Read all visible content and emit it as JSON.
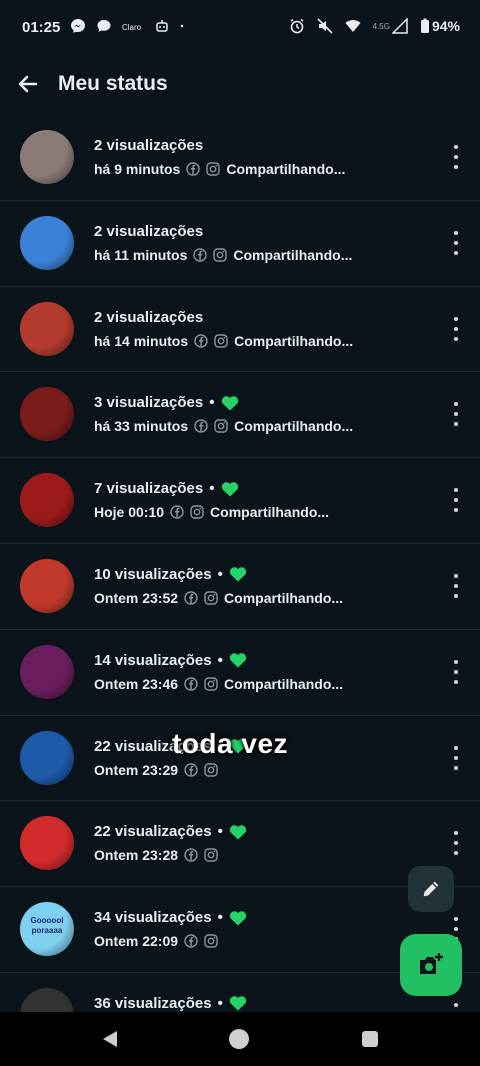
{
  "status_bar": {
    "time": "01:25",
    "left_icons": [
      "messenger-icon",
      "chat-bubble-icon",
      "claro-icon",
      "robot-icon",
      "dot-icon"
    ],
    "right_icons": [
      "alarm-icon",
      "mute-icon",
      "wifi-icon",
      "network-icon",
      "battery-icon"
    ],
    "network_label": "4.5G",
    "battery": "94%"
  },
  "header": {
    "title": "Meu status"
  },
  "rows": [
    {
      "views": "2 visualizações",
      "time": "há 9 minutos",
      "share": "Compartilhando...",
      "liked": false,
      "avatar_color": "#8a7b76"
    },
    {
      "views": "2 visualizações",
      "time": "há 11 minutos",
      "share": "Compartilhando...",
      "liked": false,
      "avatar_color": "#3b82d6"
    },
    {
      "views": "2 visualizações",
      "time": "há 14 minutos",
      "share": "Compartilhando...",
      "liked": false,
      "avatar_color": "#b23a2e"
    },
    {
      "views": "3 visualizações",
      "time": "há 33 minutos",
      "share": "Compartilhando...",
      "liked": true,
      "avatar_color": "#7a1d1a"
    },
    {
      "views": "7 visualizações",
      "time": "Hoje 00:10",
      "share": "Compartilhando...",
      "liked": true,
      "avatar_color": "#9b1b1b"
    },
    {
      "views": "10 visualizações",
      "time": "Ontem 23:52",
      "share": "Compartilhando...",
      "liked": true,
      "avatar_color": "#c0392b"
    },
    {
      "views": "14 visualizações",
      "time": "Ontem 23:46",
      "share": "Compartilhando...",
      "liked": true,
      "avatar_color": "#6a1f5c"
    },
    {
      "views": "22 visualizações",
      "time": "Ontem 23:29",
      "share": "",
      "liked": true,
      "avatar_color": "#1e5aa8"
    },
    {
      "views": "22 visualizações",
      "time": "Ontem 23:28",
      "share": "",
      "liked": true,
      "avatar_color": "#d22b2b"
    },
    {
      "views": "34 visualizações",
      "time": "Ontem 22:09",
      "share": "",
      "liked": true,
      "avatar_color": "#7fd0ef",
      "avatar_text": "Goooool poraaaa"
    },
    {
      "views": "36 visualizações",
      "time": "",
      "share": "",
      "liked": true,
      "avatar_color": "#333"
    }
  ],
  "overlay_caption": "toda vez",
  "colors": {
    "background": "#0b141a",
    "accent_green": "#21c063",
    "heart_green": "#25d366"
  }
}
